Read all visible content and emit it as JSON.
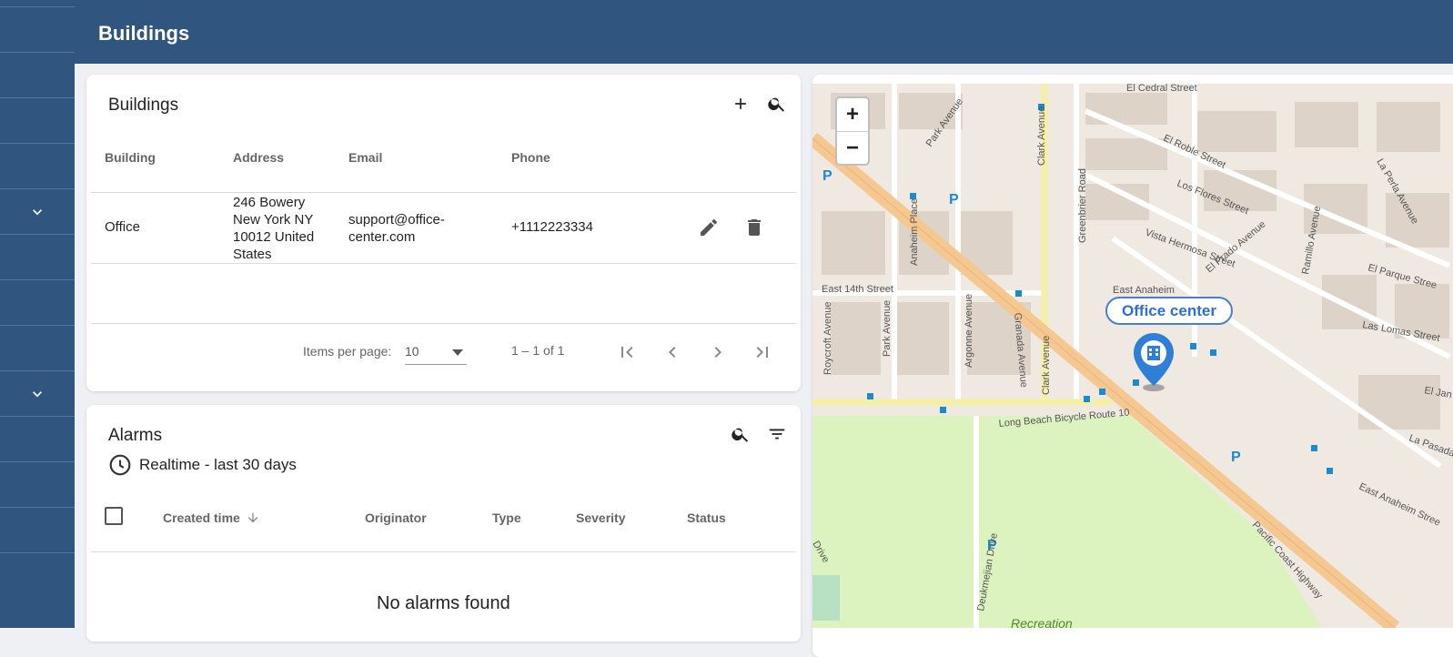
{
  "header": {
    "title": "Buildings"
  },
  "buildings": {
    "title": "Buildings",
    "columns": [
      "Building",
      "Address",
      "Email",
      "Phone"
    ],
    "rows": [
      {
        "building": "Office",
        "address_lines": [
          "246 Bowery",
          "New York NY",
          "10012 United",
          "States"
        ],
        "email_lines": [
          "support@office-",
          "center.com"
        ],
        "phone": "+1112223334"
      }
    ],
    "pager": {
      "items_per_page_label": "Items per page:",
      "page_size": "10",
      "range": "1 – 1 of 1"
    }
  },
  "alarms": {
    "title": "Alarms",
    "timewindow": "Realtime - last 30 days",
    "columns": [
      "Created time",
      "Originator",
      "Type",
      "Severity",
      "Status"
    ],
    "empty_text": "No alarms found"
  },
  "map": {
    "zoom_in": "+",
    "zoom_out": "−",
    "marker_label": "Office center",
    "streets": [
      "El Cedral Street",
      "Park Avenue",
      "Clark Avenue",
      "El Roble Street",
      "Los Flores Street",
      "Greenbrier Road",
      "Ramillo Avenue",
      "La Perla Avenue",
      "Vista Hermosa Street",
      "El Prado Avenue",
      "El Parque Stree",
      "Anaheim Place",
      "East Anaheim",
      "East 14th Street",
      "Roycroft Avenue",
      "Park Avenue",
      "Argonne Avenue",
      "Granada Avenue",
      "Clark Avenue",
      "Las Lomas Street",
      "El Jan",
      "La Pasada S",
      "East Anaheim Stree",
      "Long Beach Bicycle Route 10",
      "Deukmejian Drive",
      "Pacific Coast Highway",
      "Drive",
      "Recreation"
    ]
  }
}
